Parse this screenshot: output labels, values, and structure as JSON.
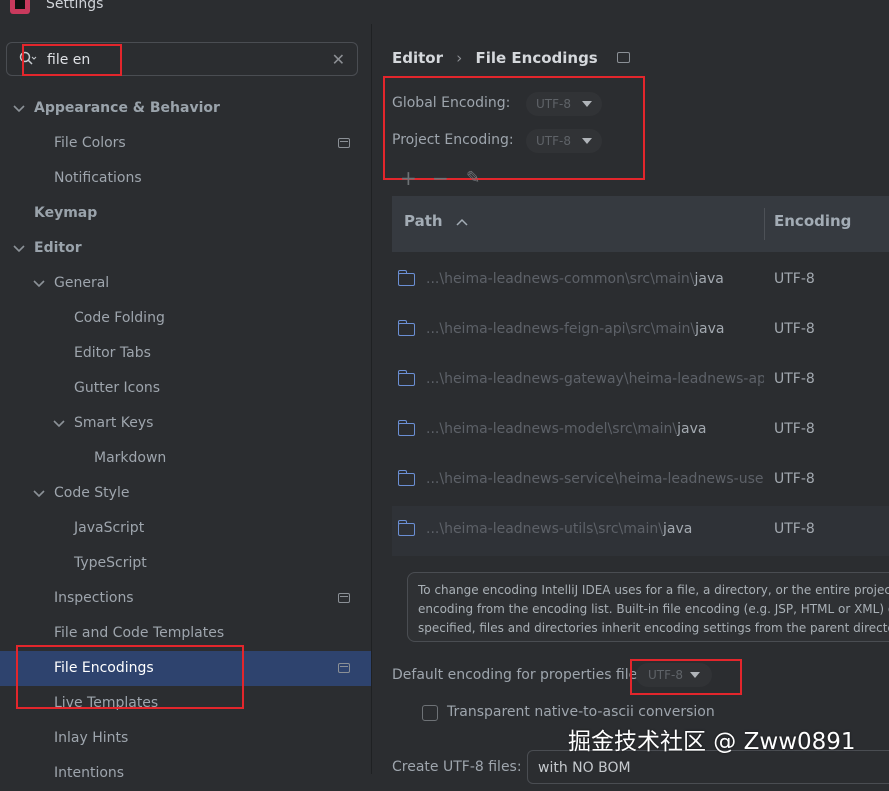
{
  "window": {
    "title": "Settings"
  },
  "search": {
    "value": "file en"
  },
  "tree": [
    {
      "label": "Appearance & Behavior",
      "chevron": "down"
    },
    {
      "label": "File Colors",
      "project_icon": true
    },
    {
      "label": "Notifications"
    },
    {
      "label": "Keymap"
    },
    {
      "label": "Editor",
      "chevron": "down"
    },
    {
      "label": "General",
      "chevron": "down"
    },
    {
      "label": "Code Folding"
    },
    {
      "label": "Editor Tabs"
    },
    {
      "label": "Gutter Icons"
    },
    {
      "label": "Smart Keys",
      "chevron": "down"
    },
    {
      "label": "Markdown"
    },
    {
      "label": "Code Style",
      "chevron": "down"
    },
    {
      "label": "JavaScript"
    },
    {
      "label": "TypeScript"
    },
    {
      "label": "Inspections",
      "project_icon": true
    },
    {
      "label": "File and Code Templates"
    },
    {
      "label": "File Encodings",
      "project_icon": true,
      "selected": true
    },
    {
      "label": "Live Templates"
    },
    {
      "label": "Inlay Hints"
    },
    {
      "label": "Intentions"
    }
  ],
  "breadcrumb": {
    "parent": "Editor",
    "separator": "›",
    "current": "File Encodings"
  },
  "global_encoding": {
    "label": "Global Encoding:",
    "value": "UTF-8"
  },
  "project_encoding": {
    "label": "Project Encoding:",
    "value": "UTF-8"
  },
  "toolbar": {
    "add": "+",
    "remove": "−",
    "edit": "✎"
  },
  "table": {
    "headers": {
      "path": "Path",
      "sort_indicator": "^",
      "encoding": "Encoding"
    },
    "rows": [
      {
        "prefix": "...\\heima-leadnews-common\\src\\main\\",
        "tail": "java",
        "encoding": "UTF-8"
      },
      {
        "prefix": "...\\heima-leadnews-feign-api\\src\\main\\",
        "tail": "java",
        "encoding": "UTF-8"
      },
      {
        "prefix": "...\\heima-leadnews-gateway\\heima-leadnews-app-ga",
        "tail": "",
        "encoding": "UTF-8"
      },
      {
        "prefix": "...\\heima-leadnews-model\\src\\main\\",
        "tail": "java",
        "encoding": "UTF-8"
      },
      {
        "prefix": "...\\heima-leadnews-service\\heima-leadnews-user\\sr",
        "tail": "",
        "encoding": "UTF-8"
      },
      {
        "prefix": "...\\heima-leadnews-utils\\src\\main\\",
        "tail": "java",
        "encoding": "UTF-8"
      }
    ]
  },
  "info": {
    "line1": "To change encoding IntelliJ IDEA uses for a file, a directory, or the entire project, a",
    "line2": "encoding from the encoding list. Built-in file encoding (e.g. JSP, HTML or XML) ove",
    "line3": "specified, files and directories inherit encoding settings from the parent directory o"
  },
  "properties": {
    "label": "Default encoding for properties files:",
    "value": "UTF-8"
  },
  "native_to_ascii": {
    "label": "Transparent native-to-ascii conversion",
    "checked": false
  },
  "create_utf8": {
    "label": "Create UTF-8 files:",
    "value": "with NO BOM"
  },
  "watermark": "掘金技术社区 @ Zww0891",
  "colors": {
    "annotation_red": "#e3262c",
    "selection": "#2e436e",
    "folder": "#6b8fd4"
  }
}
